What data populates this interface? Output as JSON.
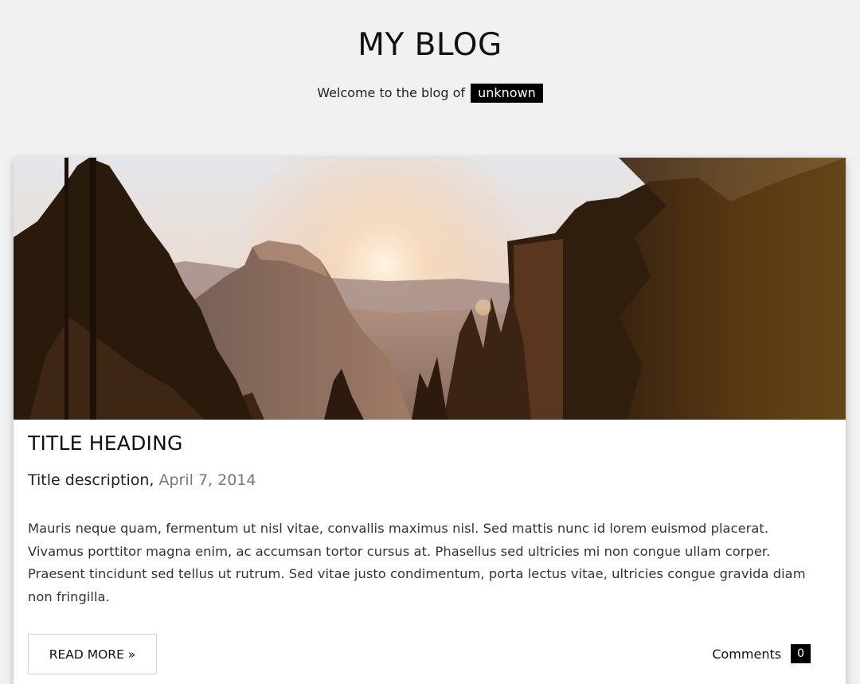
{
  "header": {
    "title": "MY BLOG",
    "tagline_prefix": "Welcome to the blog of",
    "owner": "unknown"
  },
  "post": {
    "image_alt": "Mountain valley at sunrise with pine trees",
    "title": "TITLE HEADING",
    "description": "Title description,",
    "date": "April 7, 2014",
    "body": "Mauris neque quam, fermentum ut nisl vitae, convallis maximus nisl. Sed mattis nunc id lorem euismod placerat. Vivamus porttitor magna enim, ac accumsan tortor cursus at. Phasellus sed ultricies mi non congue ullam corper. Praesent tincidunt sed tellus ut rutrum. Sed vitae justo condimentum, porta lectus vitae, ultricies congue gravida diam non fringilla.",
    "read_more_label": "READ MORE »",
    "comments_label": "Comments",
    "comments_count": "0"
  },
  "colors": {
    "background": "#f1f1f1",
    "card": "#ffffff",
    "badge": "#000000",
    "date": "#777777"
  }
}
